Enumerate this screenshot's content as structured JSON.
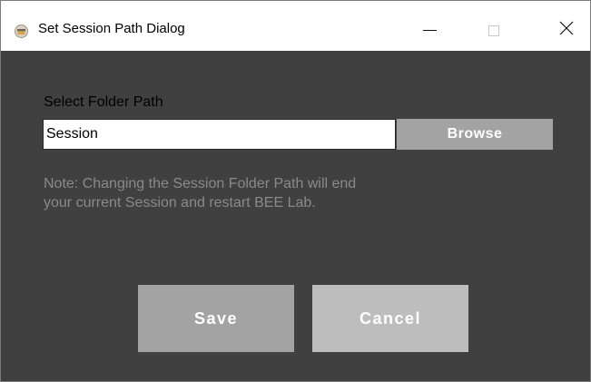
{
  "window": {
    "title": "Set Session Path Dialog",
    "icon": "app-icon"
  },
  "dialog": {
    "folder_label": "Select Folder Path",
    "path_value": "Session",
    "browse_label": "Browse",
    "note_line1": "Note: Changing the Session Folder Path will end",
    "note_line2": "your current Session and restart BEE Lab.",
    "save_label": "Save",
    "cancel_label": "Cancel"
  },
  "colors": {
    "background": "#404040",
    "button": "#a3a3a3",
    "cancel_button": "#bdbdbd",
    "note_text": "#8a8a8a"
  }
}
